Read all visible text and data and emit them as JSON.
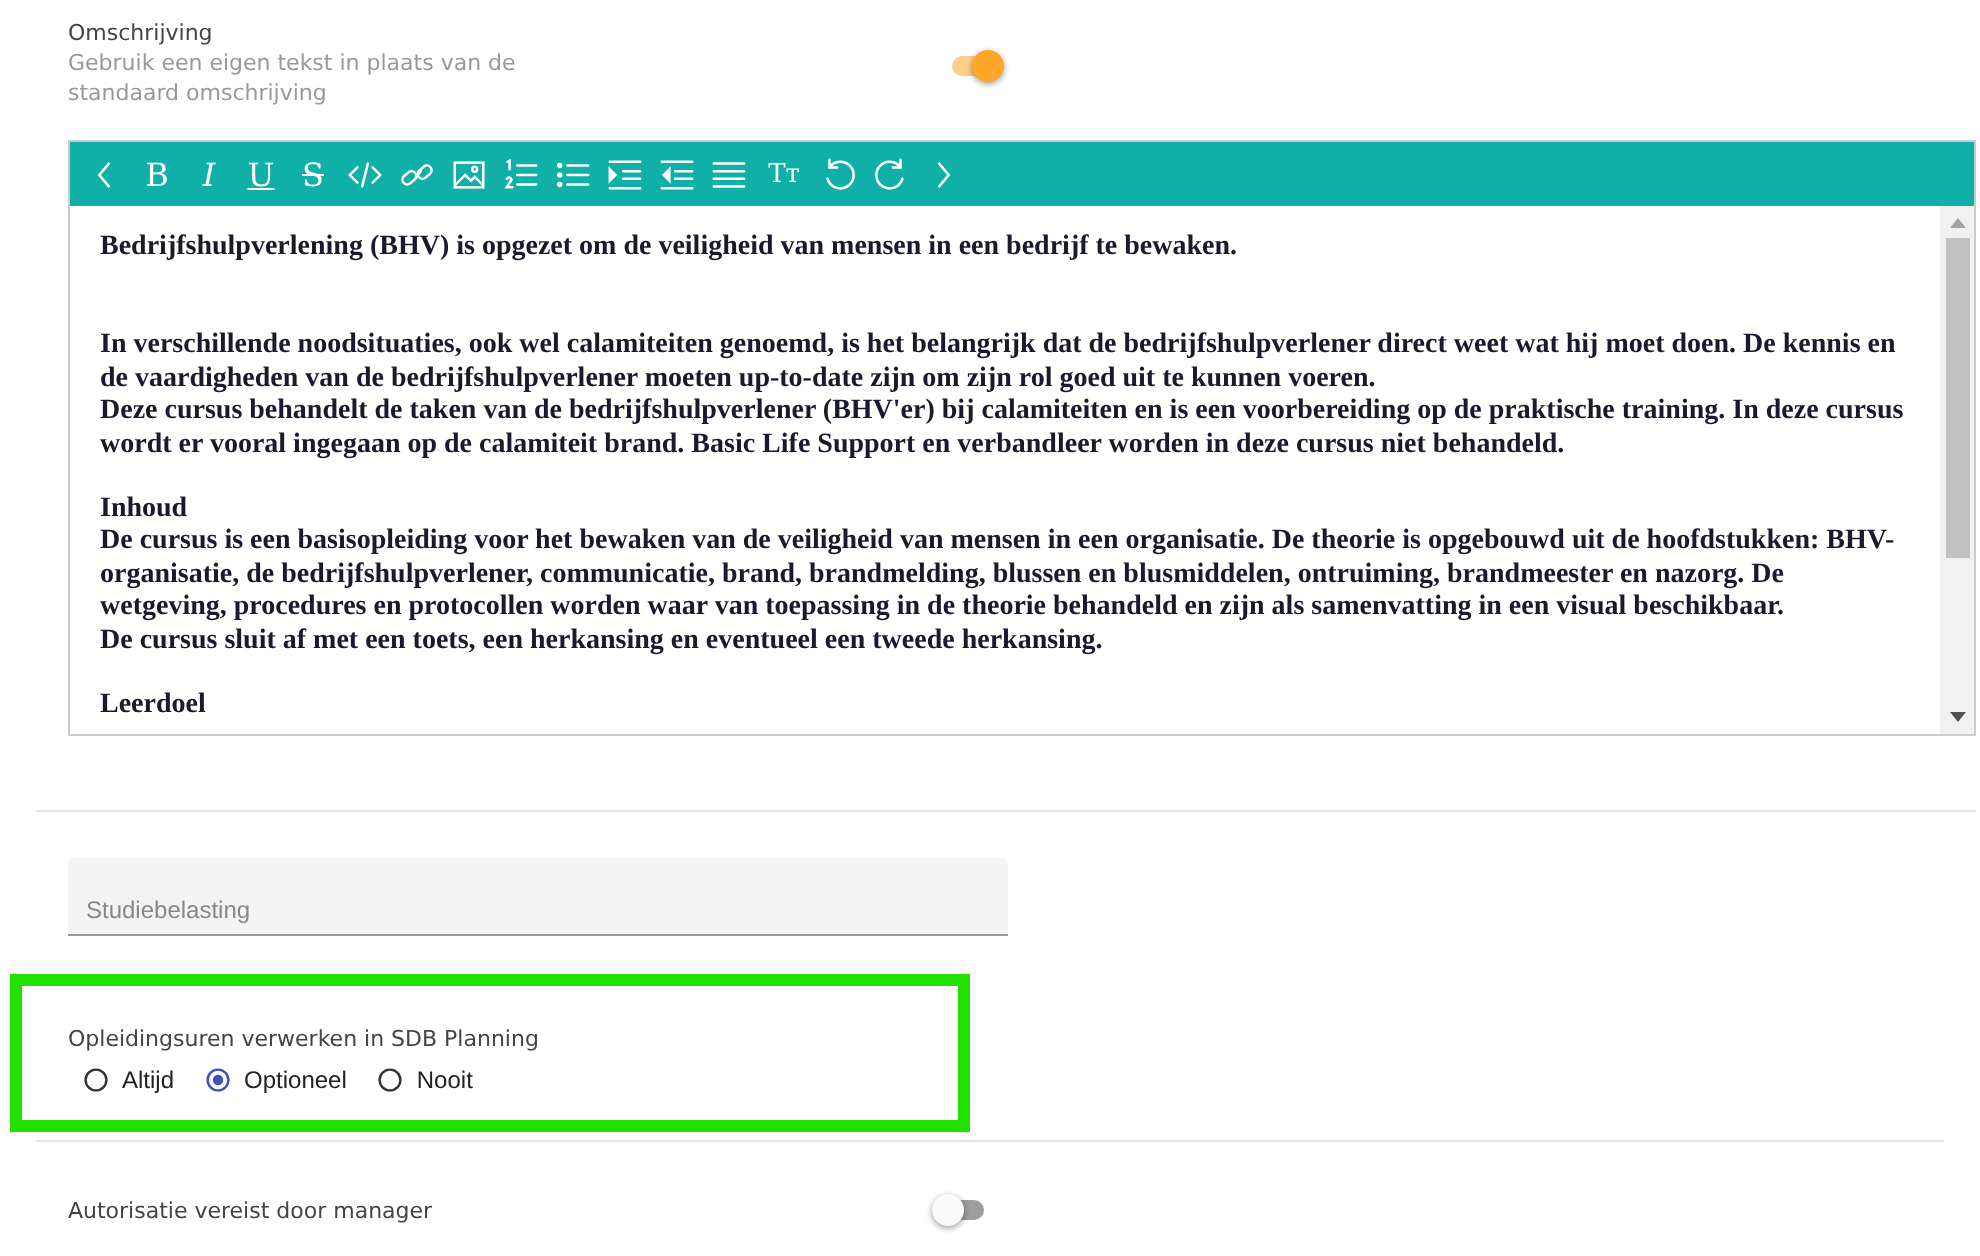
{
  "description_setting": {
    "label": "Omschrijving",
    "hint": "Gebruik een eigen tekst in plaats van de standaard omschrijving",
    "on": true
  },
  "editor": {
    "toolbar": [
      {
        "kind": "icon"
      },
      {
        "kind": "glyph",
        "text": "B"
      },
      {
        "kind": "glyph",
        "text": "I"
      },
      {
        "kind": "glyph",
        "text": "U"
      },
      {
        "kind": "glyph",
        "text": "S"
      },
      {
        "kind": "icon"
      },
      {
        "kind": "icon"
      },
      {
        "kind": "icon"
      },
      {
        "kind": "icon"
      },
      {
        "kind": "icon"
      },
      {
        "kind": "icon"
      },
      {
        "kind": "icon"
      },
      {
        "kind": "icon"
      },
      {
        "kind": "glyph",
        "text": "Tт"
      },
      {
        "kind": "icon"
      },
      {
        "kind": "icon"
      },
      {
        "kind": "icon"
      }
    ],
    "paragraphs": [
      {
        "lines": [
          "Bedrijfshulpverlening (BHV) is opgezet om de veiligheid van mensen in een bedrijf te bewaken."
        ]
      },
      {
        "kind": "blank"
      },
      {
        "lines": [
          "In verschillende noodsituaties, ook wel calamiteiten genoemd, is het belangrijk dat de bedrijfshulpverlener direct weet wat hij moet doen. De kennis en",
          "de vaardigheden van de bedrijfshulpverlener moeten up-to-date zijn om zijn rol goed uit te kunnen voeren.",
          "Deze cursus behandelt de taken van de bedrijfshulpverlener (BHV'er) bij calamiteiten en is een voorbereiding op de praktische training. In deze cursus",
          "wordt er vooral ingegaan op de calamiteit brand. Basic Life Support en verbandleer worden in deze cursus niet behandeld."
        ]
      },
      {
        "lines": [
          "Inhoud",
          "De cursus is een basisopleiding voor het bewaken van de veiligheid van mensen in een organisatie. De theorie is opgebouwd uit de hoofdstukken: BHV-",
          "organisatie, de bedrijfshulpverlener, communicatie, brand, brandmelding, blussen en blusmiddelen, ontruiming, brandmeester en nazorg. De",
          "wetgeving, procedures en protocollen worden waar van toepassing in de theorie behandeld en zijn als samenvatting in een visual beschikbaar.",
          "De cursus sluit af met een toets, een herkansing en eventueel een tweede herkansing."
        ]
      },
      {
        "lines": [
          "Leerdoel"
        ]
      }
    ]
  },
  "study_load": {
    "placeholder": "Studiebelasting"
  },
  "planning": {
    "label": "Opleidingsuren verwerken in SDB Planning",
    "options": [
      {
        "label": "Altijd",
        "selected": false
      },
      {
        "label": "Optioneel",
        "selected": true
      },
      {
        "label": "Nooit",
        "selected": false
      }
    ]
  },
  "authorization_setting": {
    "label": "Autorisatie vereist door manager",
    "on": false
  }
}
